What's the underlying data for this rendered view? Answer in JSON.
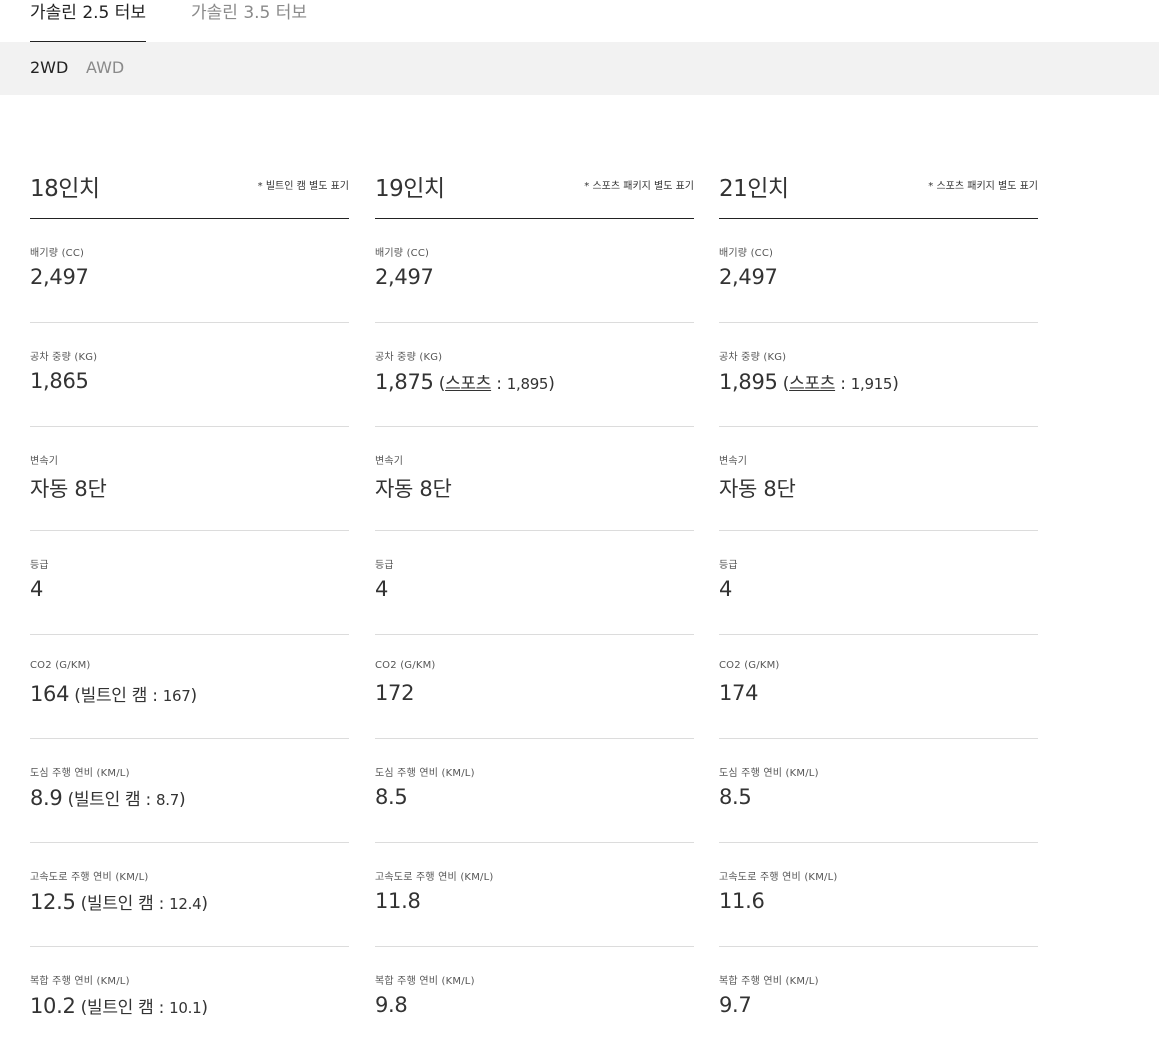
{
  "tabs": [
    {
      "label": "가솔린 2.5 터보",
      "active": true
    },
    {
      "label": "가솔린 3.5 터보",
      "active": false
    }
  ],
  "drivetrain": [
    {
      "label": "2WD",
      "active": true
    },
    {
      "label": "AWD",
      "active": false
    }
  ],
  "columns": [
    {
      "title": "18인치",
      "note": "* 빌트인 캠 별도 표기",
      "specs": [
        {
          "label": "배기량 (CC)",
          "value": "2,497"
        },
        {
          "label": "공차 중량 (KG)",
          "value": "1,865"
        },
        {
          "label": "변속기",
          "value": "자동 8단"
        },
        {
          "label": "등급",
          "value": "4"
        },
        {
          "label": "CO2 (G/KM)",
          "value": "164",
          "extra_label": "빌트인 캠",
          "extra_value": "167"
        },
        {
          "label": "도심 주행 연비 (KM/L)",
          "value": "8.9",
          "extra_label": "빌트인 캠",
          "extra_value": "8.7"
        },
        {
          "label": "고속도로 주행 연비 (KM/L)",
          "value": "12.5",
          "extra_label": "빌트인 캠",
          "extra_value": "12.4"
        },
        {
          "label": "복합 주행 연비 (KM/L)",
          "value": "10.2",
          "extra_label": "빌트인 캠",
          "extra_value": "10.1"
        }
      ]
    },
    {
      "title": "19인치",
      "note": "* 스포츠 패키지 별도 표기",
      "specs": [
        {
          "label": "배기량 (CC)",
          "value": "2,497"
        },
        {
          "label": "공차 중량 (KG)",
          "value": "1,875",
          "extra_label": "스포츠",
          "extra_value": "1,895",
          "underline": true
        },
        {
          "label": "변속기",
          "value": "자동 8단"
        },
        {
          "label": "등급",
          "value": "4"
        },
        {
          "label": "CO2 (G/KM)",
          "value": "172"
        },
        {
          "label": "도심 주행 연비 (KM/L)",
          "value": "8.5"
        },
        {
          "label": "고속도로 주행 연비 (KM/L)",
          "value": "11.8"
        },
        {
          "label": "복합 주행 연비 (KM/L)",
          "value": "9.8"
        }
      ]
    },
    {
      "title": "21인치",
      "note": "* 스포츠 패키지 별도 표기",
      "specs": [
        {
          "label": "배기량 (CC)",
          "value": "2,497"
        },
        {
          "label": "공차 중량 (KG)",
          "value": "1,895",
          "extra_label": "스포츠",
          "extra_value": "1,915",
          "underline": true
        },
        {
          "label": "변속기",
          "value": "자동 8단"
        },
        {
          "label": "등급",
          "value": "4"
        },
        {
          "label": "CO2 (G/KM)",
          "value": "174"
        },
        {
          "label": "도심 주행 연비 (KM/L)",
          "value": "8.5"
        },
        {
          "label": "고속도로 주행 연비 (KM/L)",
          "value": "11.6"
        },
        {
          "label": "복합 주행 연비 (KM/L)",
          "value": "9.7"
        }
      ]
    }
  ]
}
